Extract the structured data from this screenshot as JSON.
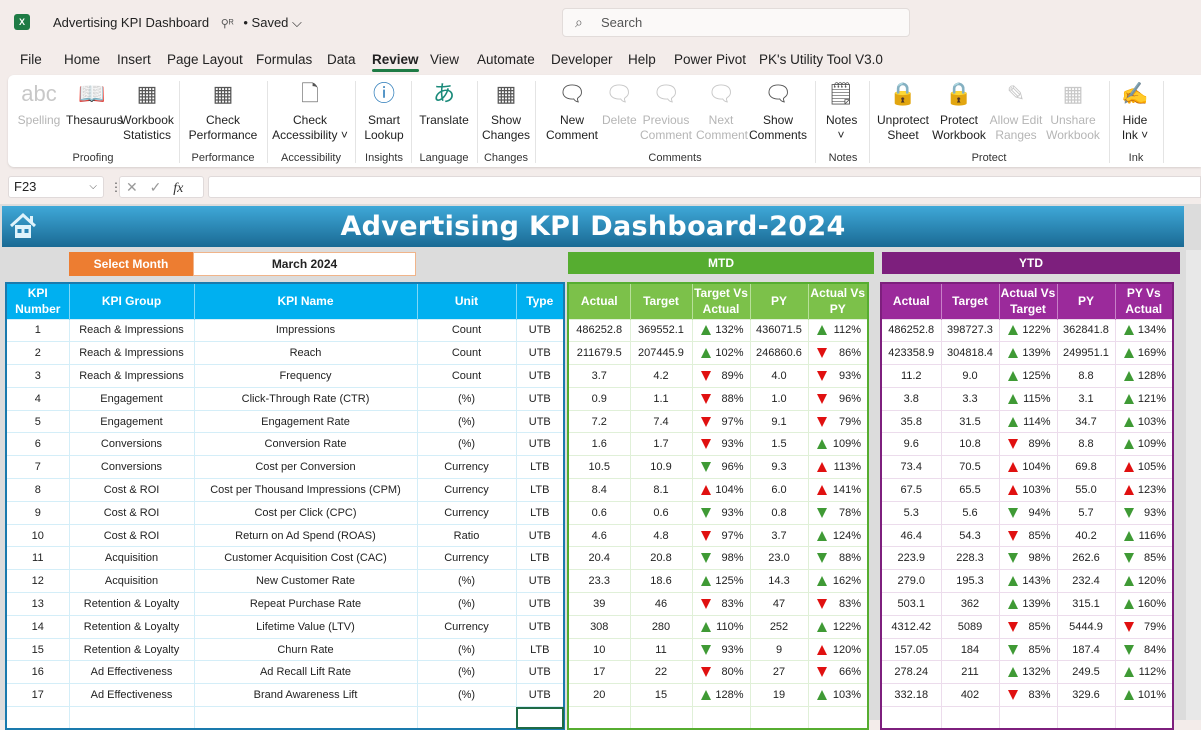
{
  "app": {
    "logo": "X",
    "doc_title": "Advertising KPI Dashboard",
    "share_icon": "⚲ᴿ",
    "saved_status": "• Saved ⌵",
    "search_placeholder": "Search"
  },
  "menu": [
    "File",
    "Home",
    "Insert",
    "Page Layout",
    "Formulas",
    "Data",
    "Review",
    "View",
    "Automate",
    "Developer",
    "Help",
    "Power Pivot",
    "PK's Utility Tool V3.0"
  ],
  "menu_active": "Review",
  "ribbon": {
    "buttons": [
      {
        "id": "spelling",
        "label": "Spelling",
        "icon": "abc",
        "disabled": true
      },
      {
        "id": "thesaurus",
        "label": "Thesaurus",
        "icon": "📖",
        "disabled": false
      },
      {
        "id": "workbook-statistics",
        "label": "Workbook Statistics",
        "icon": "▦",
        "disabled": false
      },
      {
        "id": "check-performance",
        "label": "Check Performance",
        "icon": "▦",
        "disabled": false
      },
      {
        "id": "check-accessibility",
        "label": "Check Accessibility ˅",
        "icon": "🗋",
        "disabled": false
      },
      {
        "id": "smart-lookup",
        "label": "Smart Lookup",
        "icon": "ⓘ",
        "disabled": false
      },
      {
        "id": "translate",
        "label": "Translate",
        "icon": "あ",
        "disabled": false
      },
      {
        "id": "show-changes",
        "label": "Show Changes",
        "icon": "▦",
        "disabled": false
      },
      {
        "id": "new-comment",
        "label": "New Comment",
        "icon": "🗨",
        "disabled": false
      },
      {
        "id": "delete-comment",
        "label": "Delete",
        "icon": "🗨",
        "disabled": true
      },
      {
        "id": "previous-comment",
        "label": "Previous Comment",
        "icon": "🗨",
        "disabled": true
      },
      {
        "id": "next-comment",
        "label": "Next Comment",
        "icon": "🗨",
        "disabled": true
      },
      {
        "id": "show-comments",
        "label": "Show Comments",
        "icon": "🗨",
        "disabled": false
      },
      {
        "id": "notes",
        "label": "Notes ˅",
        "icon": "🗒",
        "disabled": false
      },
      {
        "id": "unprotect-sheet",
        "label": "Unprotect Sheet",
        "icon": "🔒",
        "disabled": false
      },
      {
        "id": "protect-workbook",
        "label": "Protect Workbook",
        "icon": "🔒",
        "disabled": false
      },
      {
        "id": "allow-edit-ranges",
        "label": "Allow Edit Ranges",
        "icon": "✎",
        "disabled": true
      },
      {
        "id": "unshare-workbook",
        "label": "Unshare Workbook",
        "icon": "▦",
        "disabled": true
      },
      {
        "id": "hide-ink",
        "label": "Hide Ink ˅",
        "icon": "✍",
        "disabled": false
      }
    ],
    "groups": [
      "Proofing",
      "Performance",
      "Accessibility",
      "Insights",
      "Language",
      "Changes",
      "Comments",
      "Notes",
      "Protect",
      "Ink"
    ]
  },
  "formula_bar": {
    "name_box": "F23",
    "cancel": "✕",
    "enter": "✓",
    "fx": "fx",
    "value": ""
  },
  "dashboard": {
    "title": "Advertising KPI Dashboard-2024",
    "select_month_label": "Select Month",
    "selected_month": "March 2024",
    "mtd_label": "MTD",
    "ytd_label": "YTD",
    "info_headers": [
      "KPI Number",
      "KPI Group",
      "KPI Name",
      "Unit",
      "Type"
    ],
    "mtd_headers": [
      "Actual",
      "Target",
      "Target Vs Actual",
      "PY",
      "Actual Vs PY"
    ],
    "ytd_headers": [
      "Actual",
      "Target",
      "Actual Vs Target",
      "PY",
      "PY Vs Actual"
    ],
    "colors": {
      "up_good": "#3f9a35",
      "down_bad": "#e01010",
      "mtd": "#56ad30",
      "ytd": "#7d1f7d",
      "info": "#00b0f0",
      "select_month": "#ed7d31"
    },
    "rows": [
      {
        "no": "1",
        "group": "Reach & Impressions",
        "name": "Impressions",
        "unit": "Count",
        "type": "UTB",
        "mtd": {
          "actual": "486252.8",
          "target": "369552.1",
          "tva": "132%",
          "tva_dir": "up",
          "tva_color": "green",
          "py": "436071.5",
          "avp": "112%",
          "avp_dir": "up",
          "avp_color": "green"
        },
        "ytd": {
          "actual": "486252.8",
          "target": "398727.3",
          "avt": "122%",
          "avt_dir": "up",
          "avt_color": "green",
          "py": "362841.8",
          "pva": "134%",
          "pva_dir": "up",
          "pva_color": "green"
        }
      },
      {
        "no": "2",
        "group": "Reach & Impressions",
        "name": "Reach",
        "unit": "Count",
        "type": "UTB",
        "mtd": {
          "actual": "211679.5",
          "target": "207445.9",
          "tva": "102%",
          "tva_dir": "up",
          "tva_color": "green",
          "py": "246860.6",
          "avp": "86%",
          "avp_dir": "down",
          "avp_color": "red"
        },
        "ytd": {
          "actual": "423358.9",
          "target": "304818.4",
          "avt": "139%",
          "avt_dir": "up",
          "avt_color": "green",
          "py": "249951.1",
          "pva": "169%",
          "pva_dir": "up",
          "pva_color": "green"
        }
      },
      {
        "no": "3",
        "group": "Reach & Impressions",
        "name": "Frequency",
        "unit": "Count",
        "type": "UTB",
        "mtd": {
          "actual": "3.7",
          "target": "4.2",
          "tva": "89%",
          "tva_dir": "down",
          "tva_color": "red",
          "py": "4.0",
          "avp": "93%",
          "avp_dir": "down",
          "avp_color": "red"
        },
        "ytd": {
          "actual": "11.2",
          "target": "9.0",
          "avt": "125%",
          "avt_dir": "up",
          "avt_color": "green",
          "py": "8.8",
          "pva": "128%",
          "pva_dir": "up",
          "pva_color": "green"
        }
      },
      {
        "no": "4",
        "group": "Engagement",
        "name": "Click-Through Rate (CTR)",
        "unit": "(%)",
        "type": "UTB",
        "mtd": {
          "actual": "0.9",
          "target": "1.1",
          "tva": "88%",
          "tva_dir": "down",
          "tva_color": "red",
          "py": "1.0",
          "avp": "96%",
          "avp_dir": "down",
          "avp_color": "red"
        },
        "ytd": {
          "actual": "3.8",
          "target": "3.3",
          "avt": "115%",
          "avt_dir": "up",
          "avt_color": "green",
          "py": "3.1",
          "pva": "121%",
          "pva_dir": "up",
          "pva_color": "green"
        }
      },
      {
        "no": "5",
        "group": "Engagement",
        "name": "Engagement Rate",
        "unit": "(%)",
        "type": "UTB",
        "mtd": {
          "actual": "7.2",
          "target": "7.4",
          "tva": "97%",
          "tva_dir": "down",
          "tva_color": "red",
          "py": "9.1",
          "avp": "79%",
          "avp_dir": "down",
          "avp_color": "red"
        },
        "ytd": {
          "actual": "35.8",
          "target": "31.5",
          "avt": "114%",
          "avt_dir": "up",
          "avt_color": "green",
          "py": "34.7",
          "pva": "103%",
          "pva_dir": "up",
          "pva_color": "green"
        }
      },
      {
        "no": "6",
        "group": "Conversions",
        "name": "Conversion Rate",
        "unit": "(%)",
        "type": "UTB",
        "mtd": {
          "actual": "1.6",
          "target": "1.7",
          "tva": "93%",
          "tva_dir": "down",
          "tva_color": "red",
          "py": "1.5",
          "avp": "109%",
          "avp_dir": "up",
          "avp_color": "green"
        },
        "ytd": {
          "actual": "9.6",
          "target": "10.8",
          "avt": "89%",
          "avt_dir": "down",
          "avt_color": "red",
          "py": "8.8",
          "pva": "109%",
          "pva_dir": "up",
          "pva_color": "green"
        }
      },
      {
        "no": "7",
        "group": "Conversions",
        "name": "Cost per Conversion",
        "unit": "Currency",
        "type": "LTB",
        "mtd": {
          "actual": "10.5",
          "target": "10.9",
          "tva": "96%",
          "tva_dir": "down",
          "tva_color": "green",
          "py": "9.3",
          "avp": "113%",
          "avp_dir": "up",
          "avp_color": "red"
        },
        "ytd": {
          "actual": "73.4",
          "target": "70.5",
          "avt": "104%",
          "avt_dir": "up",
          "avt_color": "red",
          "py": "69.8",
          "pva": "105%",
          "pva_dir": "up",
          "pva_color": "red"
        }
      },
      {
        "no": "8",
        "group": "Cost & ROI",
        "name": "Cost per Thousand Impressions (CPM)",
        "unit": "Currency",
        "type": "LTB",
        "mtd": {
          "actual": "8.4",
          "target": "8.1",
          "tva": "104%",
          "tva_dir": "up",
          "tva_color": "red",
          "py": "6.0",
          "avp": "141%",
          "avp_dir": "up",
          "avp_color": "red"
        },
        "ytd": {
          "actual": "67.5",
          "target": "65.5",
          "avt": "103%",
          "avt_dir": "up",
          "avt_color": "red",
          "py": "55.0",
          "pva": "123%",
          "pva_dir": "up",
          "pva_color": "red"
        }
      },
      {
        "no": "9",
        "group": "Cost & ROI",
        "name": "Cost per Click (CPC)",
        "unit": "Currency",
        "type": "LTB",
        "mtd": {
          "actual": "0.6",
          "target": "0.6",
          "tva": "93%",
          "tva_dir": "down",
          "tva_color": "green",
          "py": "0.8",
          "avp": "78%",
          "avp_dir": "down",
          "avp_color": "green"
        },
        "ytd": {
          "actual": "5.3",
          "target": "5.6",
          "avt": "94%",
          "avt_dir": "down",
          "avt_color": "green",
          "py": "5.7",
          "pva": "93%",
          "pva_dir": "down",
          "pva_color": "green"
        }
      },
      {
        "no": "10",
        "group": "Cost & ROI",
        "name": "Return on Ad Spend (ROAS)",
        "unit": "Ratio",
        "type": "UTB",
        "mtd": {
          "actual": "4.6",
          "target": "4.8",
          "tva": "97%",
          "tva_dir": "down",
          "tva_color": "red",
          "py": "3.7",
          "avp": "124%",
          "avp_dir": "up",
          "avp_color": "green"
        },
        "ytd": {
          "actual": "46.4",
          "target": "54.3",
          "avt": "85%",
          "avt_dir": "down",
          "avt_color": "red",
          "py": "40.2",
          "pva": "116%",
          "pva_dir": "up",
          "pva_color": "green"
        }
      },
      {
        "no": "11",
        "group": "Acquisition",
        "name": "Customer Acquisition Cost (CAC)",
        "unit": "Currency",
        "type": "LTB",
        "mtd": {
          "actual": "20.4",
          "target": "20.8",
          "tva": "98%",
          "tva_dir": "down",
          "tva_color": "green",
          "py": "23.0",
          "avp": "88%",
          "avp_dir": "down",
          "avp_color": "green"
        },
        "ytd": {
          "actual": "223.9",
          "target": "228.3",
          "avt": "98%",
          "avt_dir": "down",
          "avt_color": "green",
          "py": "262.6",
          "pva": "85%",
          "pva_dir": "down",
          "pva_color": "green"
        }
      },
      {
        "no": "12",
        "group": "Acquisition",
        "name": "New Customer Rate",
        "unit": "(%)",
        "type": "UTB",
        "mtd": {
          "actual": "23.3",
          "target": "18.6",
          "tva": "125%",
          "tva_dir": "up",
          "tva_color": "green",
          "py": "14.3",
          "avp": "162%",
          "avp_dir": "up",
          "avp_color": "green"
        },
        "ytd": {
          "actual": "279.0",
          "target": "195.3",
          "avt": "143%",
          "avt_dir": "up",
          "avt_color": "green",
          "py": "232.4",
          "pva": "120%",
          "pva_dir": "up",
          "pva_color": "green"
        }
      },
      {
        "no": "13",
        "group": "Retention & Loyalty",
        "name": "Repeat Purchase Rate",
        "unit": "(%)",
        "type": "UTB",
        "mtd": {
          "actual": "39",
          "target": "46",
          "tva": "83%",
          "tva_dir": "down",
          "tva_color": "red",
          "py": "47",
          "avp": "83%",
          "avp_dir": "down",
          "avp_color": "red"
        },
        "ytd": {
          "actual": "503.1",
          "target": "362",
          "avt": "139%",
          "avt_dir": "up",
          "avt_color": "green",
          "py": "315.1",
          "pva": "160%",
          "pva_dir": "up",
          "pva_color": "green"
        }
      },
      {
        "no": "14",
        "group": "Retention & Loyalty",
        "name": "Lifetime Value (LTV)",
        "unit": "Currency",
        "type": "UTB",
        "mtd": {
          "actual": "308",
          "target": "280",
          "tva": "110%",
          "tva_dir": "up",
          "tva_color": "green",
          "py": "252",
          "avp": "122%",
          "avp_dir": "up",
          "avp_color": "green"
        },
        "ytd": {
          "actual": "4312.42",
          "target": "5089",
          "avt": "85%",
          "avt_dir": "down",
          "avt_color": "red",
          "py": "5444.9",
          "pva": "79%",
          "pva_dir": "down",
          "pva_color": "red"
        }
      },
      {
        "no": "15",
        "group": "Retention & Loyalty",
        "name": "Churn Rate",
        "unit": "(%)",
        "type": "LTB",
        "mtd": {
          "actual": "10",
          "target": "11",
          "tva": "93%",
          "tva_dir": "down",
          "tva_color": "green",
          "py": "9",
          "avp": "120%",
          "avp_dir": "up",
          "avp_color": "red"
        },
        "ytd": {
          "actual": "157.05",
          "target": "184",
          "avt": "85%",
          "avt_dir": "down",
          "avt_color": "green",
          "py": "187.4",
          "pva": "84%",
          "pva_dir": "down",
          "pva_color": "green"
        }
      },
      {
        "no": "16",
        "group": "Ad Effectiveness",
        "name": "Ad Recall Lift Rate",
        "unit": "(%)",
        "type": "UTB",
        "mtd": {
          "actual": "17",
          "target": "22",
          "tva": "80%",
          "tva_dir": "down",
          "tva_color": "red",
          "py": "27",
          "avp": "66%",
          "avp_dir": "down",
          "avp_color": "red"
        },
        "ytd": {
          "actual": "278.24",
          "target": "211",
          "avt": "132%",
          "avt_dir": "up",
          "avt_color": "green",
          "py": "249.5",
          "pva": "112%",
          "pva_dir": "up",
          "pva_color": "green"
        }
      },
      {
        "no": "17",
        "group": "Ad Effectiveness",
        "name": "Brand Awareness Lift",
        "unit": "(%)",
        "type": "UTB",
        "mtd": {
          "actual": "20",
          "target": "15",
          "tva": "128%",
          "tva_dir": "up",
          "tva_color": "green",
          "py": "19",
          "avp": "103%",
          "avp_dir": "up",
          "avp_color": "green"
        },
        "ytd": {
          "actual": "332.18",
          "target": "402",
          "avt": "83%",
          "avt_dir": "down",
          "avt_color": "red",
          "py": "329.6",
          "pva": "101%",
          "pva_dir": "up",
          "pva_color": "green"
        }
      }
    ]
  }
}
